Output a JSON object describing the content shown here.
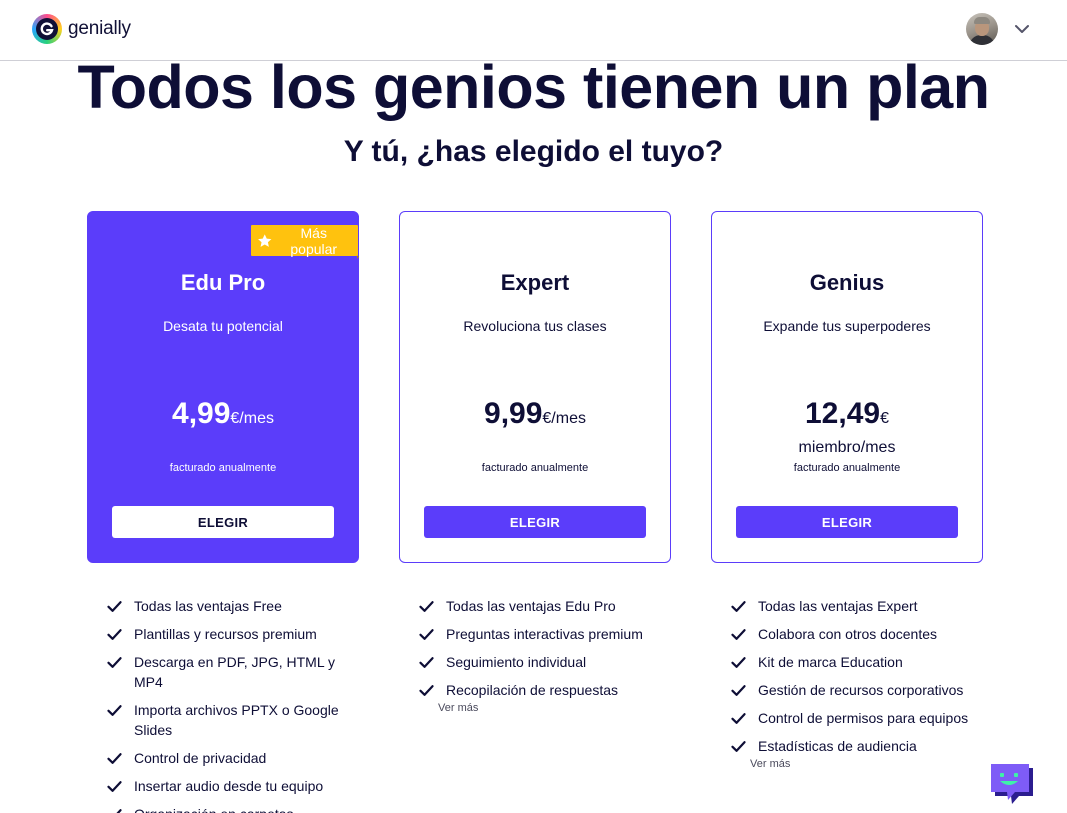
{
  "header": {
    "brand": "genially",
    "logo_icon": "genially-logo-icon",
    "avatar_icon": "user-avatar",
    "menu_icon": "chevron-down-icon"
  },
  "hero": {
    "title": "Todos los genios tienen un plan",
    "subtitle": "Y tú, ¿has elegido el tuyo?"
  },
  "colors": {
    "accent": "#5b3dfa",
    "badge": "#ffc20e",
    "text": "#0e0e36"
  },
  "plans": [
    {
      "name": "Edu Pro",
      "tagline": "Desata tu potencial",
      "price": "4,99",
      "unit": "€/mes",
      "unit_line2": "",
      "billing": "facturado anualmente",
      "button": "ELEGIR",
      "badge": "Más popular",
      "features": [
        "Todas las ventajas Free",
        "Plantillas y recursos premium",
        "Descarga en PDF, JPG, HTML y MP4",
        "Importa archivos PPTX o Google Slides",
        "Control de privacidad",
        "Insertar audio desde tu equipo",
        "Organización en carpetas"
      ],
      "see_more": ""
    },
    {
      "name": "Expert",
      "tagline": "Revoluciona tus clases",
      "price": "9,99",
      "unit": "€/mes",
      "unit_line2": "",
      "billing": "facturado anualmente",
      "button": "ELEGIR",
      "badge": "",
      "features": [
        "Todas las ventajas Edu Pro",
        "Preguntas interactivas premium",
        "Seguimiento individual",
        "Recopilación de respuestas"
      ],
      "see_more": "Ver más"
    },
    {
      "name": "Genius",
      "tagline": "Expande tus superpoderes",
      "price": "12,49",
      "unit": "€",
      "unit_line2": "miembro/mes",
      "billing": "facturado anualmente",
      "button": "ELEGIR",
      "badge": "",
      "features": [
        "Todas las ventajas Expert",
        "Colabora con otros docentes",
        "Kit de marca Education",
        "Gestión de recursos corporativos",
        "Control de permisos para equipos",
        "Estadísticas de audiencia"
      ],
      "see_more": "Ver más"
    }
  ],
  "chat_widget": {
    "icon": "chat-bot-icon"
  }
}
